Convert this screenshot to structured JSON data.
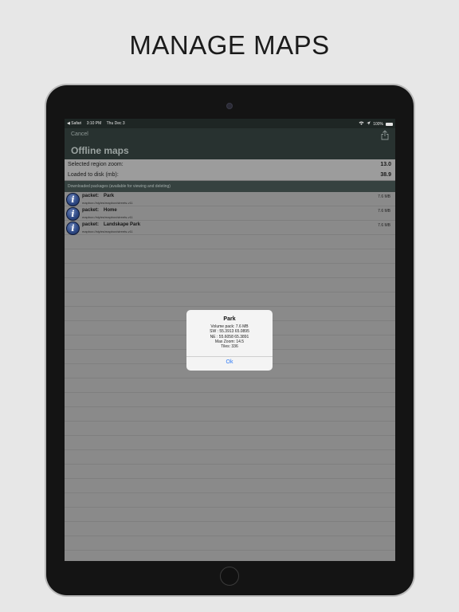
{
  "headline": "MANAGE MAPS",
  "statusbar": {
    "back_app": "◀ Safari",
    "time": "3:10 PM",
    "date": "Thu Dec 3",
    "battery_text": "100%"
  },
  "navbar": {
    "cancel_label": "Cancel",
    "title": "Offline maps",
    "share_icon": "share-icon"
  },
  "info": [
    {
      "label": "Selected region zoom:",
      "value": "13.0"
    },
    {
      "label": "Loaded to disk (mb):",
      "value": "38.9"
    }
  ],
  "section_header": "Downloaded packages (available for viewing and deleting)",
  "packages": [
    {
      "keyword": "packet:",
      "name": "Park",
      "url": "mapbox://styles/mapbox/streets-v11",
      "size": "7.6 MB",
      "icon": "i"
    },
    {
      "keyword": "packet:",
      "name": "Home",
      "url": "mapbox://styles/mapbox/streets-v11",
      "size": "7.6 MB",
      "icon": "i"
    },
    {
      "keyword": "packet:",
      "name": "Landskape Park",
      "url": "mapbox://styles/mapbox/streets-v11",
      "size": "7.6 MB",
      "icon": "i"
    }
  ],
  "alert": {
    "title": "Park",
    "lines": [
      "Volume pack: 7.6 MB",
      "SW : 55.3913 65.0895",
      "NE : 55.6058 65.3891",
      "Max Zoom: 14.5",
      "Tiles: 336"
    ],
    "ok_label": "Ok"
  },
  "colors": {
    "navbar": "#283230",
    "section_header": "#364240",
    "screen_dim": "#8a8a8a",
    "alert_button": "#2f7bf6"
  }
}
